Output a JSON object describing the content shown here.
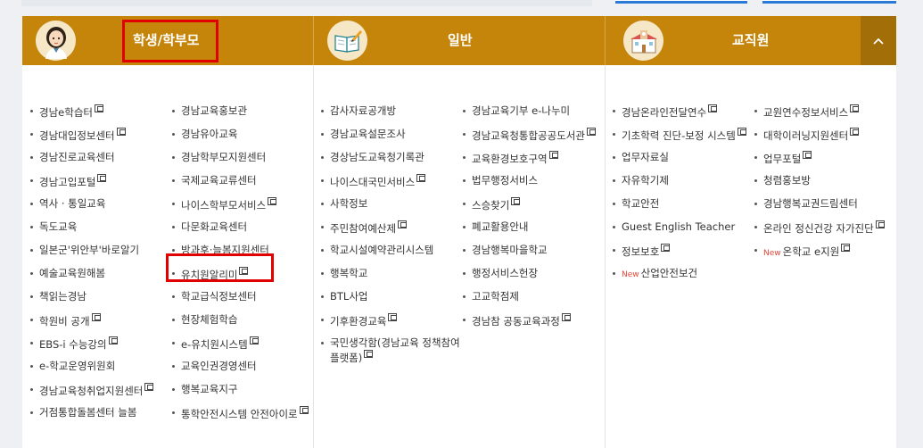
{
  "header": {
    "col1_title": "학생/학부모",
    "col2_title": "일반",
    "col3_title": "교직원"
  },
  "colors": {
    "header_bg": "#c4850a",
    "highlight": "#e00000",
    "new_badge": "#e2473a"
  },
  "icons": [
    "student-avatar-icon",
    "book-pencil-icon",
    "school-building-icon",
    "chevron-up-icon",
    "external-link-icon"
  ],
  "col1a": [
    {
      "label": "경남e학습터",
      "ext": true
    },
    {
      "label": "경남대입정보센터",
      "ext": true
    },
    {
      "label": "경남진로교육센터",
      "ext": false
    },
    {
      "label": "경남고입포털",
      "ext": true
    },
    {
      "label": "역사 · 통일교육",
      "ext": false
    },
    {
      "label": "독도교육",
      "ext": false
    },
    {
      "label": "일본군'위안부'바로알기",
      "ext": false
    },
    {
      "label": "예술교육원해봄",
      "ext": false
    },
    {
      "label": "책읽는경남",
      "ext": false
    },
    {
      "label": "학원비 공개",
      "ext": true
    },
    {
      "label": "EBS-i 수능강의",
      "ext": true
    },
    {
      "label": "e-학교운영위원회",
      "ext": false
    },
    {
      "label": "경남교육청취업지원센터",
      "ext": true
    },
    {
      "label": "거점통합돌봄센터 늘봄",
      "ext": false
    }
  ],
  "col1b": [
    {
      "label": "경남교육홍보관",
      "ext": false
    },
    {
      "label": "경남유아교육",
      "ext": false
    },
    {
      "label": "경남학부모지원센터",
      "ext": false
    },
    {
      "label": "국제교육교류센터",
      "ext": false
    },
    {
      "label": "나이스학부모서비스",
      "ext": true
    },
    {
      "label": "다문화교육센터",
      "ext": false
    },
    {
      "label": "방과후·늘봄지원센터",
      "ext": false
    },
    {
      "label": "유치원알리미",
      "ext": true
    },
    {
      "label": "학교급식정보센터",
      "ext": false
    },
    {
      "label": "현장체험학습",
      "ext": false
    },
    {
      "label": "e-유치원시스템",
      "ext": true
    },
    {
      "label": "교육인권경영센터",
      "ext": false
    },
    {
      "label": "행복교육지구",
      "ext": false
    },
    {
      "label": "통학안전시스템 안전아이로",
      "ext": true
    }
  ],
  "col2a": [
    {
      "label": "감사자료공개방",
      "ext": false
    },
    {
      "label": "경남교육설문조사",
      "ext": false
    },
    {
      "label": "경상남도교육청기록관",
      "ext": false
    },
    {
      "label": "나이스대국민서비스",
      "ext": true
    },
    {
      "label": "사학정보",
      "ext": false
    },
    {
      "label": "주민참여예산제",
      "ext": true
    },
    {
      "label": "학교시설예약관리시스템",
      "ext": false
    },
    {
      "label": "행복학교",
      "ext": false
    },
    {
      "label": "BTL사업",
      "ext": false
    },
    {
      "label": "기후환경교육",
      "ext": true
    },
    {
      "label": "국민생각함(경남교육 정책참여플랫폼)",
      "ext": true
    }
  ],
  "col2b": [
    {
      "label": "경남교육기부 e-나누미",
      "ext": false
    },
    {
      "label": "경남교육청통합공공도서관",
      "ext": true
    },
    {
      "label": "교육환경보호구역",
      "ext": true
    },
    {
      "label": "법무행정서비스",
      "ext": false
    },
    {
      "label": "스승찾기",
      "ext": true
    },
    {
      "label": "폐교활용안내",
      "ext": false
    },
    {
      "label": "경남행복마을학교",
      "ext": false
    },
    {
      "label": "행정서비스헌장",
      "ext": false
    },
    {
      "label": "고교학점제",
      "ext": false
    },
    {
      "label": "경남참 공동교육과정",
      "ext": true
    }
  ],
  "col3a": [
    {
      "label": "경남온라인전달연수",
      "ext": true,
      "new": false
    },
    {
      "label": "기초학력 진단-보정 시스템",
      "ext": true,
      "new": false
    },
    {
      "label": "업무자료실",
      "ext": false,
      "new": false
    },
    {
      "label": "자유학기제",
      "ext": false,
      "new": false
    },
    {
      "label": "학교안전",
      "ext": false,
      "new": false
    },
    {
      "label": "Guest English Teacher",
      "ext": false,
      "new": false
    },
    {
      "label": "정보보호",
      "ext": true,
      "new": false
    },
    {
      "label": "산업안전보건",
      "ext": false,
      "new": true
    }
  ],
  "col3b": [
    {
      "label": "교원연수정보서비스",
      "ext": true,
      "new": false
    },
    {
      "label": "대학이러닝지원센터",
      "ext": true,
      "new": false
    },
    {
      "label": "업무포털",
      "ext": true,
      "new": false
    },
    {
      "label": "청렴홍보방",
      "ext": false,
      "new": false
    },
    {
      "label": "경남행복교권드림센터",
      "ext": false,
      "new": false
    },
    {
      "label": "온라인 정신건강 자가진단",
      "ext": true,
      "new": false
    },
    {
      "label": "온학교 e지원",
      "ext": true,
      "new": true
    }
  ],
  "new_label": "New"
}
